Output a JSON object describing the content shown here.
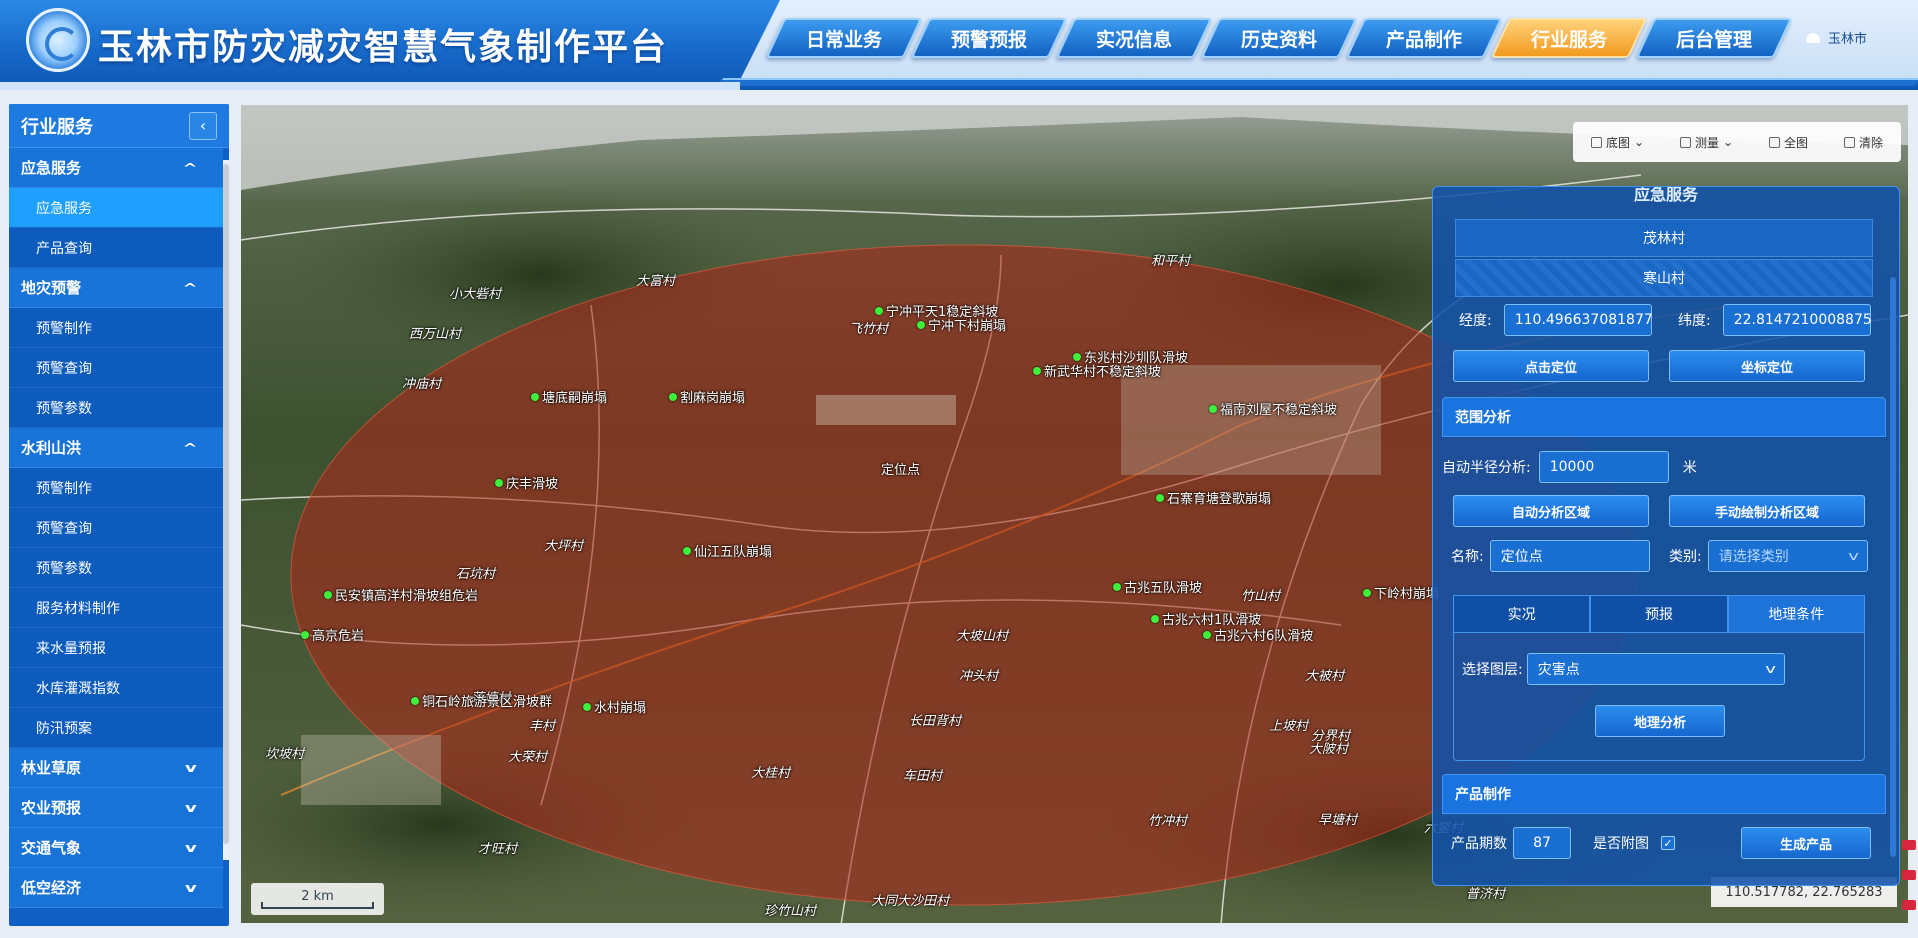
{
  "header": {
    "title": "玉林市防灾减灾智慧气象制作平台",
    "nav": [
      {
        "label": "日常业务",
        "active": false
      },
      {
        "label": "预警预报",
        "active": false
      },
      {
        "label": "实况信息",
        "active": false
      },
      {
        "label": "历史资料",
        "active": false
      },
      {
        "label": "产品制作",
        "active": false
      },
      {
        "label": "行业服务",
        "active": true
      },
      {
        "label": "后台管理",
        "active": false
      }
    ],
    "user": "玉林市",
    "accent_active": "#f29a1e"
  },
  "sidebar": {
    "title": "行业服务",
    "collapse_icon": "chevron-left-icon",
    "groups": [
      {
        "label": "应急服务",
        "expanded": true,
        "items": [
          {
            "label": "应急服务",
            "active": true
          },
          {
            "label": "产品查询"
          }
        ]
      },
      {
        "label": "地灾预警",
        "expanded": true,
        "items": [
          {
            "label": "预警制作"
          },
          {
            "label": "预警查询"
          },
          {
            "label": "预警参数"
          }
        ]
      },
      {
        "label": "水利山洪",
        "expanded": true,
        "items": [
          {
            "label": "预警制作"
          },
          {
            "label": "预警查询"
          },
          {
            "label": "预警参数"
          },
          {
            "label": "服务材料制作"
          },
          {
            "label": "来水量预报"
          },
          {
            "label": "水库灌溉指数"
          },
          {
            "label": "防汛预案"
          }
        ]
      },
      {
        "label": "林业草原",
        "expanded": false,
        "items": []
      },
      {
        "label": "农业预报",
        "expanded": false,
        "items": []
      },
      {
        "label": "交通气象",
        "expanded": false,
        "items": []
      },
      {
        "label": "低空经济",
        "expanded": false,
        "items": []
      }
    ]
  },
  "map": {
    "toolbar": {
      "basemap": "底图",
      "measure": "测量",
      "fullview": "全图",
      "clear": "清除"
    },
    "scale": "2 km",
    "coordinates": "110.517782, 22.765283",
    "center_label": "定位点",
    "place_labels": [
      "小大砦村",
      "西万山村",
      "冲庙村",
      "大富村",
      "和平村",
      "飞竹村",
      "竹冲村",
      "才旺村",
      "早塘村",
      "六鳖村",
      "大同大沙田村",
      "珍竹山村",
      "普济村",
      "长田背村",
      "车田村",
      "大桂村",
      "大荣村",
      "丰村",
      "冲头村",
      "大被村",
      "坎坡村",
      "莲塘村",
      "大坡山村",
      "竹山村",
      "大陂村",
      "分界村",
      "石坑村",
      "大坪村",
      "上坡村"
    ],
    "hazard_points": [
      {
        "label": "宁冲平天1稳定斜坡"
      },
      {
        "label": "宁冲下村崩塌"
      },
      {
        "label": "塘底嗣崩塌"
      },
      {
        "label": "割麻岗崩塌"
      },
      {
        "label": "东兆村沙圳队滑坡"
      },
      {
        "label": "新武华村不稳定斜坡"
      },
      {
        "label": "福南刘屋不稳定斜坡"
      },
      {
        "label": "庆丰滑坡"
      },
      {
        "label": "石寨育塘登歌崩塌"
      },
      {
        "label": "仙江五队崩塌"
      },
      {
        "label": "民安镇高洋村滑坡组危岩"
      },
      {
        "label": "古兆五队滑坡"
      },
      {
        "label": "下岭村崩塌"
      },
      {
        "label": "古兆六村1队滑坡"
      },
      {
        "label": "古兆六村6队滑坡"
      },
      {
        "label": "高京危岩"
      },
      {
        "label": "铜石岭旅游景区滑坡群"
      },
      {
        "label": "水村崩塌"
      }
    ],
    "buffer_color": "#b02418"
  },
  "panel": {
    "title": "应急服务",
    "villages": [
      "茂林村",
      "寒山村"
    ],
    "lon_label": "经度:",
    "lon_value": "110.496637081877",
    "lat_label": "纬度:",
    "lat_value": "22.8147210008875",
    "btn_click_locate": "点击定位",
    "btn_coord_locate": "坐标定位",
    "range_section": "范围分析",
    "radius_label": "自动半径分析:",
    "radius_value": "10000",
    "radius_unit": "米",
    "btn_auto_area": "自动分析区域",
    "btn_manual_area": "手动绘制分析区域",
    "name_label": "名称:",
    "name_value": "定位点",
    "category_label": "类别:",
    "category_placeholder": "请选择类别",
    "tabs": [
      {
        "label": "实况"
      },
      {
        "label": "预报"
      },
      {
        "label": "地理条件",
        "active": true
      }
    ],
    "layer_label": "选择图层:",
    "layer_value": "灾害点",
    "btn_geo_analysis": "地理分析",
    "product_section": "产品制作",
    "period_label": "产品期数",
    "period_value": "87",
    "attach_label": "是否附图",
    "attach_checked": true,
    "btn_generate": "生成产品"
  }
}
